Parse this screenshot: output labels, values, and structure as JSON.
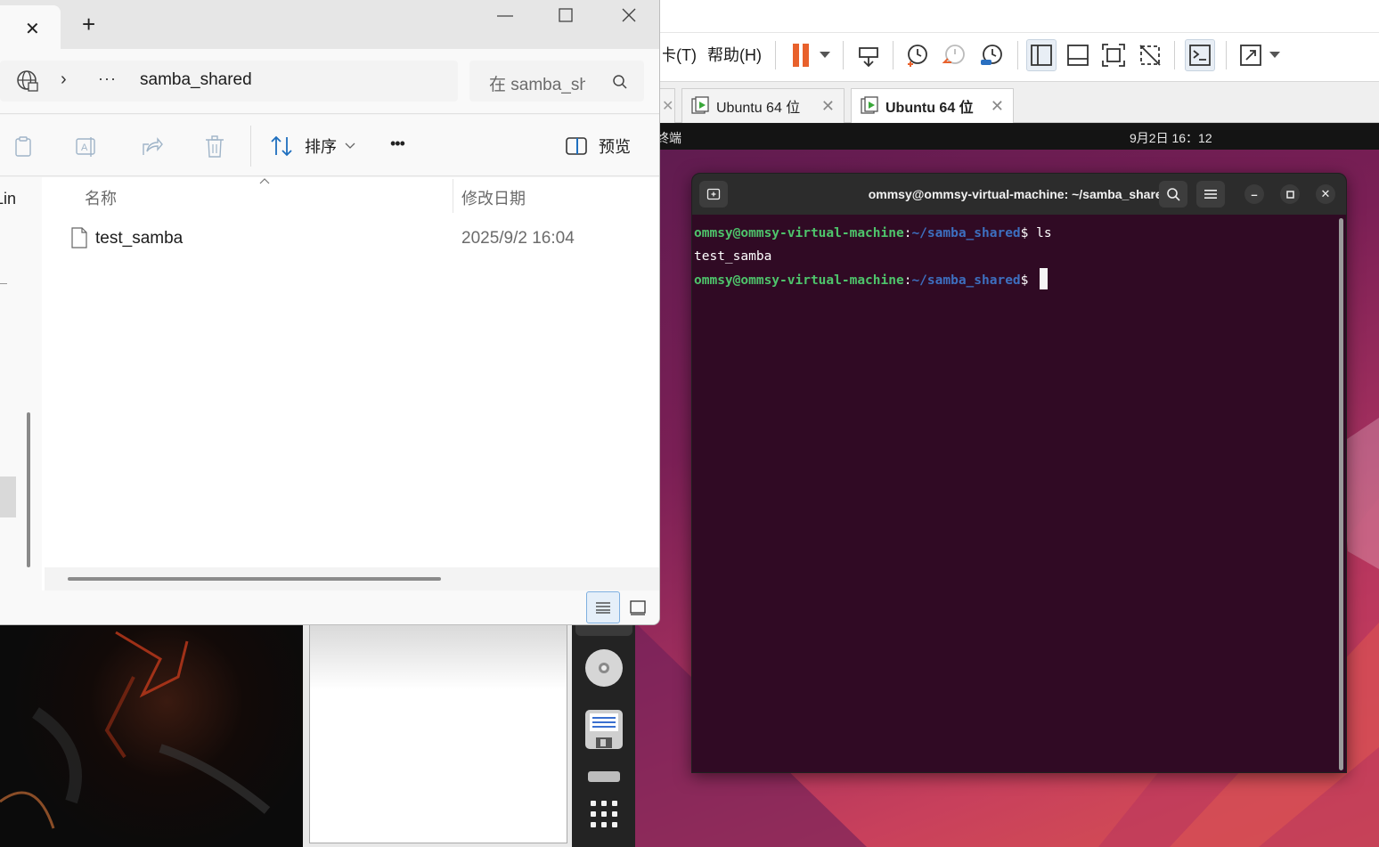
{
  "explorer": {
    "new_tab_label": "+",
    "breadcrumb_more": "···",
    "breadcrumb_folder": "samba_shared",
    "search_placeholder": "在 samba_sh",
    "toolbar": {
      "sort_label": "排序",
      "more_label": "•••",
      "preview_label": "预览"
    },
    "nav_partial_text": "Lin",
    "columns": {
      "name": "名称",
      "modified": "修改日期"
    },
    "files": [
      {
        "name": "test_samba",
        "modified": "2025/9/2 16:04",
        "icon": "document-icon"
      }
    ]
  },
  "vmware": {
    "menu_partial_tabs": "卡(T)",
    "menu_help": "帮助(H)",
    "tabs": [
      {
        "label": "Ubuntu 64 位",
        "active": false
      },
      {
        "label": "Ubuntu 64 位",
        "active": true
      }
    ],
    "toolbar_icons": [
      "pause-icon",
      "dropdown-icon",
      "send-keys-icon",
      "snapshot-icon",
      "revert-snapshot-icon",
      "snapshot-manager-icon",
      "library-icon",
      "thumbnail-bar-icon",
      "fullscreen-icon",
      "unity-icon",
      "console-icon",
      "stretch-icon",
      "stretch-dropdown-icon"
    ]
  },
  "ubuntu": {
    "activity": "终端",
    "clock": "9月2日  16：12",
    "terminal": {
      "title": "ommsy@ommsy-virtual-machine: ~/samba_shared",
      "lines": [
        {
          "user": "ommsy@ommsy-virtual-machine",
          "sep": ":",
          "path": "~/samba_shared",
          "prompt": "$ ",
          "cmd": "ls"
        },
        {
          "output": "test_samba"
        },
        {
          "user": "ommsy@ommsy-virtual-machine",
          "sep": ":",
          "path": "~/samba_shared",
          "prompt": "$ ",
          "cmd": ""
        }
      ]
    }
  },
  "colors": {
    "vmware_pause": "#e8612c",
    "terminal_bg": "#300a24",
    "prompt_user": "#4ec46b",
    "prompt_path": "#3d6fbf",
    "accent": "#1e6fbf"
  }
}
